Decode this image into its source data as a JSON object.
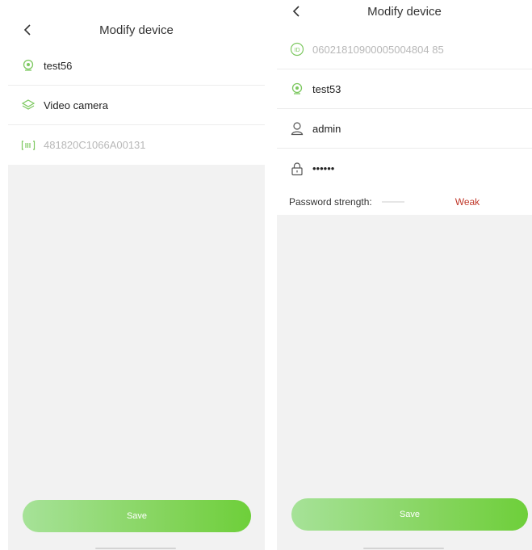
{
  "left": {
    "header": {
      "title": "Modify device"
    },
    "fields": {
      "name": "test56",
      "type": "Video camera",
      "serial": "481820C1066A00131"
    },
    "save_label": "Save"
  },
  "right": {
    "header": {
      "title": "Modify device"
    },
    "fields": {
      "device_id": "06021810900005004804 85",
      "name": "test53",
      "username": "admin",
      "password": "••••••"
    },
    "password_strength": {
      "label": "Password strength:",
      "value": "Weak"
    },
    "save_label": "Save"
  },
  "colors": {
    "accent_green": "#86d55f",
    "weak_red": "#c0392b",
    "background_gray": "#f2f2f2"
  },
  "icons": {
    "back": "chevron-left-icon",
    "name": "camera-lens-icon",
    "type": "layers-icon",
    "serial": "barcode-icon",
    "device_id": "id-badge-icon",
    "username": "user-icon",
    "password": "lock-icon"
  }
}
